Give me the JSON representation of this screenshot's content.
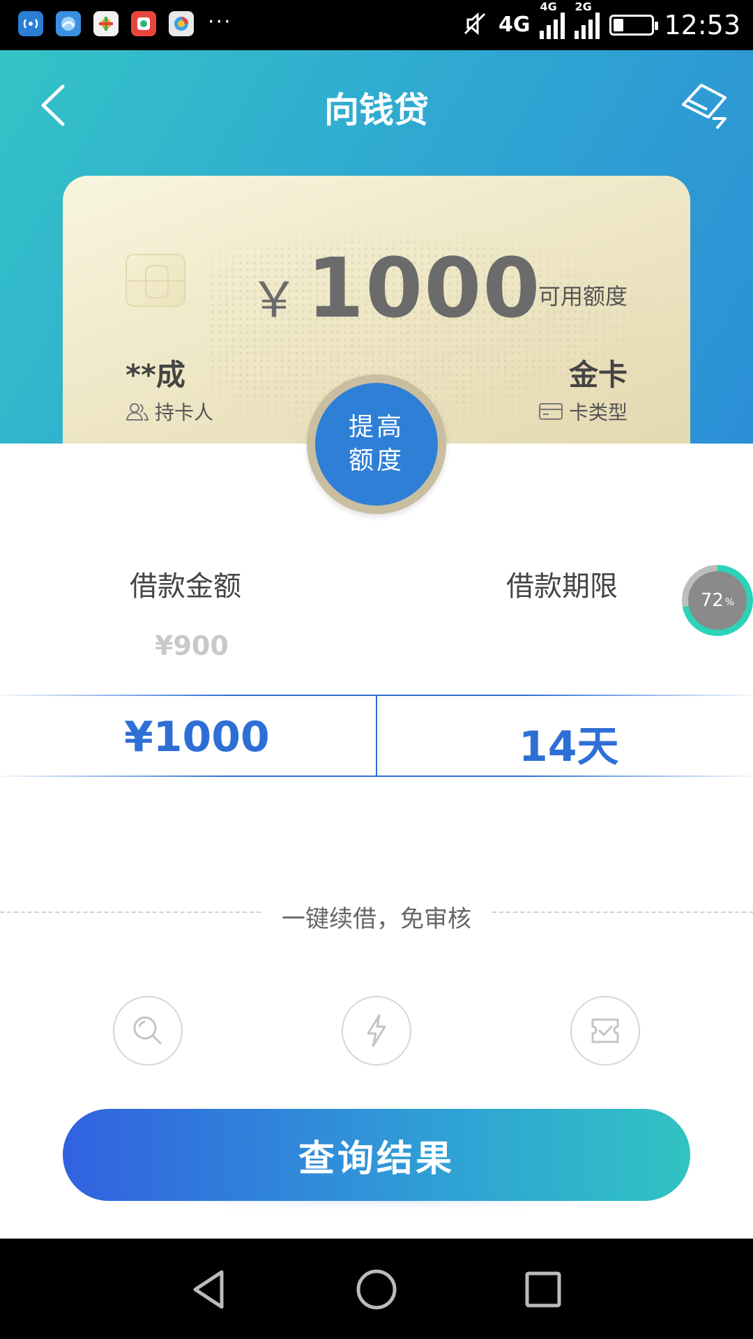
{
  "status_bar": {
    "more": "···",
    "net_4g_primary": "4G",
    "net_4g": "4G",
    "net_2g": "2G",
    "time": "12:53"
  },
  "header": {
    "title": "向钱贷"
  },
  "card": {
    "currency": "￥",
    "amount": "1000",
    "available_label": "可用额度",
    "holder_name": "**成",
    "holder_label": "持卡人",
    "card_type": "金卡",
    "card_type_label": "卡类型"
  },
  "raise_limit": {
    "label": "提高额度"
  },
  "loan": {
    "amount_title": "借款金额",
    "term_title": "借款期限",
    "prev_amount": "¥900",
    "selected_amount": "¥1000",
    "selected_term": "14天"
  },
  "progress": {
    "value": "72",
    "unit": "%",
    "fraction": 0.72
  },
  "renew": {
    "text": "一键续借，免审核"
  },
  "features": [
    {
      "icon": "search-icon"
    },
    {
      "icon": "lightning-icon"
    },
    {
      "icon": "check-ticket-icon"
    }
  ],
  "actions": {
    "query_label": "查询结果"
  },
  "colors": {
    "accent": "#2e6fd6",
    "progress": "#2cd3b8"
  }
}
